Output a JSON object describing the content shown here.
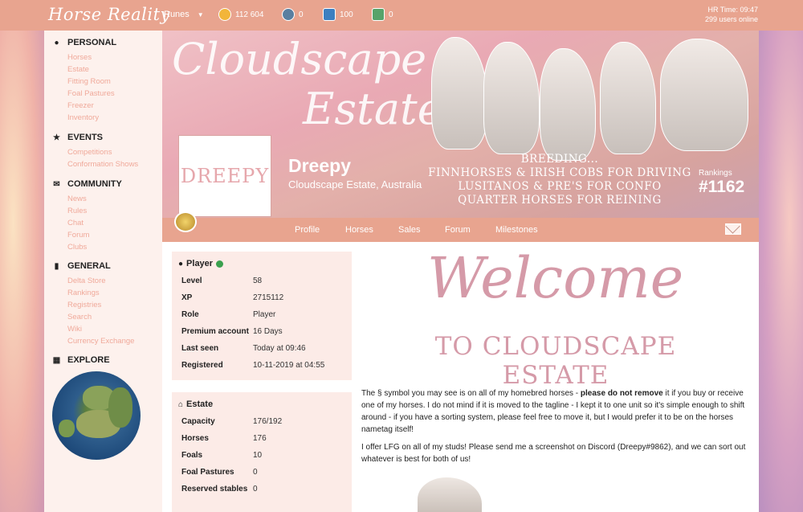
{
  "topbar": {
    "logo": "Horse Reality",
    "runes_label": "Runes",
    "currencies": [
      {
        "icon": "gold-coin-icon",
        "value": "112 604",
        "color": "#f2b53a"
      },
      {
        "icon": "horseshoe-token-icon",
        "value": "0",
        "color": "#5a7fa0"
      },
      {
        "icon": "f-token-icon",
        "value": "100",
        "color": "#3d7fc0"
      },
      {
        "icon": "cash-icon",
        "value": "0",
        "color": "#57a36a"
      }
    ],
    "hr_time": "HR Time: 09:47",
    "users_online": "299 users online"
  },
  "sidebar": {
    "personal": {
      "title": "PERSONAL",
      "items": [
        "Horses",
        "Estate",
        "Fitting Room",
        "Foal Pastures",
        "Freezer",
        "Inventory"
      ]
    },
    "events": {
      "title": "EVENTS",
      "items": [
        "Competitions",
        "Conformation Shows"
      ]
    },
    "community": {
      "title": "COMMUNITY",
      "items": [
        "News",
        "Rules",
        "Chat",
        "Forum",
        "Clubs"
      ]
    },
    "general": {
      "title": "GENERAL",
      "items": [
        "Delta Store",
        "Rankings",
        "Registries",
        "Search",
        "Wiki",
        "Currency Exchange"
      ]
    },
    "explore": {
      "title": "EXPLORE"
    }
  },
  "banner": {
    "script_line1": "Cloudscape",
    "script_line2": "Estate",
    "avatar_text": "DREEPY",
    "player_name": "Dreepy",
    "location": "Cloudscape Estate, Australia",
    "breeding_lines": [
      "BREEDING...",
      "FINNHORSES & IRISH COBS FOR DRIVING",
      "LUSITANOS & PRE'S FOR CONFO",
      "QUARTER HORSES FOR REINING"
    ],
    "rankings_label": "Rankings",
    "rankings_value": "#1162"
  },
  "tabs": [
    "Profile",
    "Horses",
    "Sales",
    "Forum",
    "Milestones"
  ],
  "player": {
    "title": "Player",
    "rows": [
      {
        "k": "Level",
        "v": "58"
      },
      {
        "k": "XP",
        "v": "2715112"
      },
      {
        "k": "Role",
        "v": "Player"
      },
      {
        "k": "Premium account",
        "v": "16 Days"
      },
      {
        "k": "Last seen",
        "v": "Today at 09:46"
      },
      {
        "k": "Registered",
        "v": "10-11-2019 at 04:55"
      }
    ]
  },
  "estate": {
    "title": "Estate",
    "rows": [
      {
        "k": "Capacity",
        "v": "176/192"
      },
      {
        "k": "Horses",
        "v": "176"
      },
      {
        "k": "Foals",
        "v": "10"
      },
      {
        "k": "Foal Pastures",
        "v": "0"
      },
      {
        "k": "Reserved stables",
        "v": "0"
      }
    ]
  },
  "welcome": {
    "title": "Welcome",
    "subtitle": "TO CLOUDSCAPE ESTATE",
    "p1a": "The § symbol you may see is on all of my homebred horses - ",
    "p1b": "please do not remove",
    "p1c": " it if you buy or receive one of my horses. I do not mind if it is moved to the tagline - I kept it to one unit so it's simple enough to shift around - if you have a sorting system, please feel free to move it, but I would prefer it to be on the horses nametag itself!",
    "p2": "I offer LFG on all of my studs! Please send me a screenshot on Discord (Dreepy#9862), and we can sort out whatever is best for both of us!"
  }
}
